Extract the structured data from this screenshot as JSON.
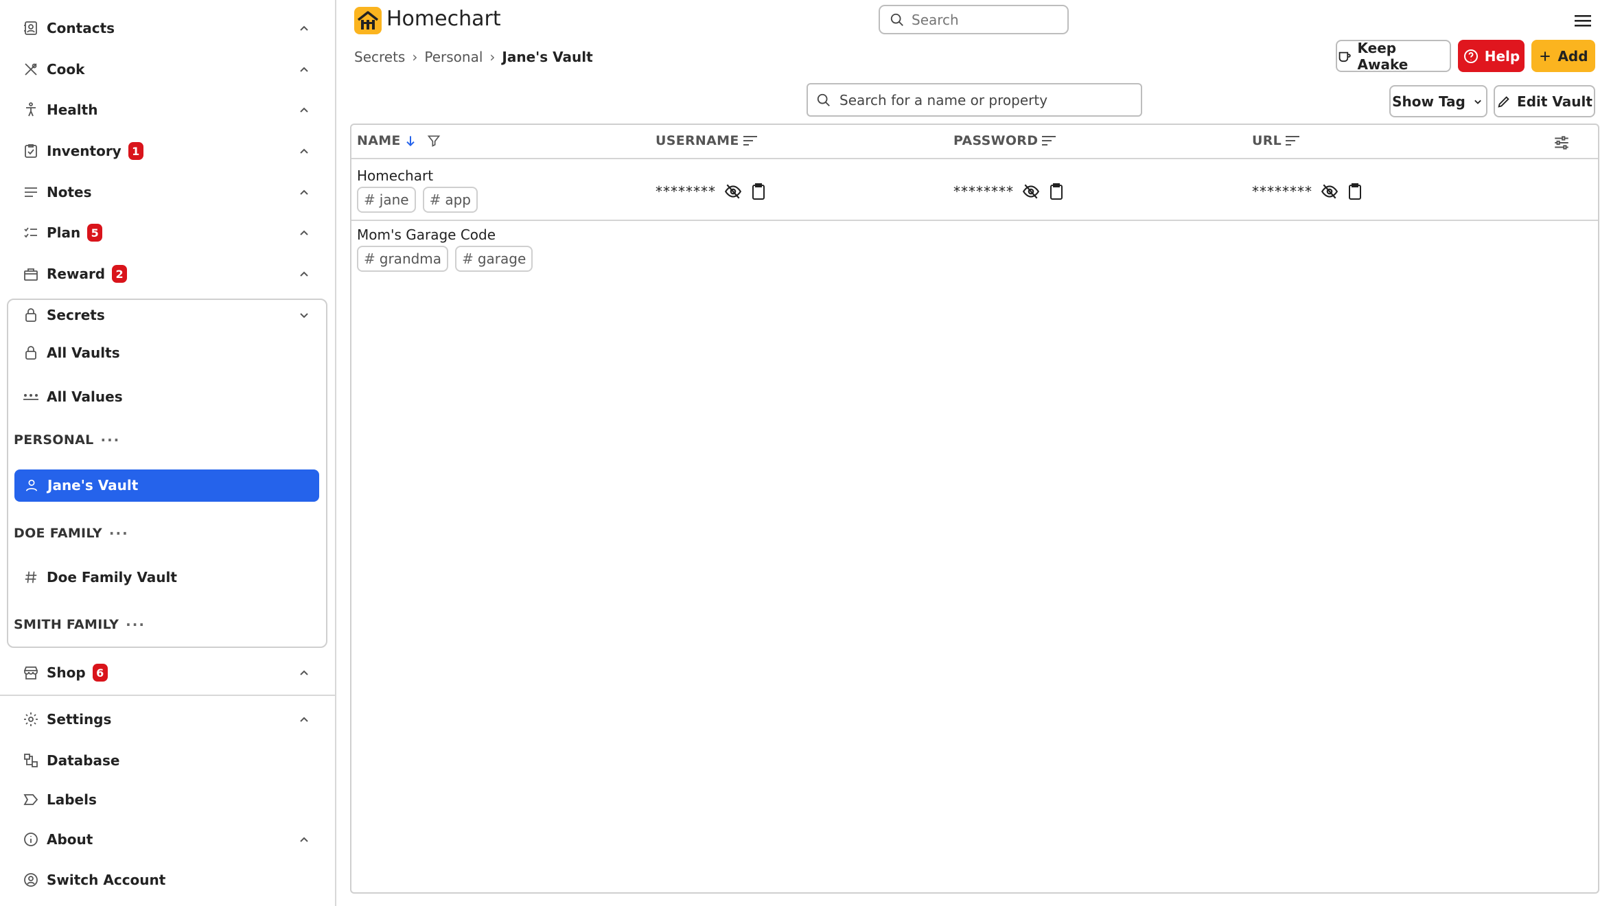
{
  "app": {
    "title": "Homechart",
    "search_placeholder": "Search"
  },
  "colors": {
    "primary": "#2563eb",
    "help": "#e0161e",
    "add": "#fbb41f",
    "badge": "#d9141b"
  },
  "sidebar": {
    "items": [
      {
        "label": "Contacts",
        "icon": "contacts-icon"
      },
      {
        "label": "Cook",
        "icon": "utensils-icon"
      },
      {
        "label": "Health",
        "icon": "person-icon"
      },
      {
        "label": "Inventory",
        "icon": "clipboard-icon",
        "badge": "1"
      },
      {
        "label": "Notes",
        "icon": "lines-icon"
      },
      {
        "label": "Plan",
        "icon": "checklist-icon",
        "badge": "5"
      },
      {
        "label": "Reward",
        "icon": "gift-icon",
        "badge": "2"
      }
    ],
    "secrets": {
      "label": "Secrets",
      "all_vaults": "All Vaults",
      "all_values": "All Values",
      "groups": [
        {
          "name": "PERSONAL",
          "vaults": [
            "Jane's Vault"
          ]
        },
        {
          "name": "DOE FAMILY",
          "vaults": [
            "Doe Family Vault"
          ]
        },
        {
          "name": "SMITH FAMILY",
          "vaults": []
        }
      ],
      "dots": "···"
    },
    "shop": {
      "label": "Shop",
      "badge": "6"
    },
    "bottom": [
      {
        "label": "Settings"
      },
      {
        "label": "Database"
      },
      {
        "label": "Labels"
      },
      {
        "label": "About"
      },
      {
        "label": "Switch Account"
      }
    ]
  },
  "breadcrumb": [
    "Secrets",
    "Personal",
    "Jane's Vault"
  ],
  "toolbar": {
    "keep_awake": "Keep Awake",
    "help": "Help",
    "add": "Add",
    "show_tag": "Show Tag",
    "edit_vault": "Edit Vault",
    "vault_search_placeholder": "Search for a name or property"
  },
  "table": {
    "columns": [
      "NAME",
      "USERNAME",
      "PASSWORD",
      "URL"
    ],
    "rows": [
      {
        "name": "Homechart",
        "tags": [
          "jane",
          "app"
        ],
        "username": "********",
        "password": "********",
        "url": "********"
      },
      {
        "name": "Mom's Garage Code",
        "tags": [
          "grandma",
          "garage"
        ]
      }
    ]
  }
}
